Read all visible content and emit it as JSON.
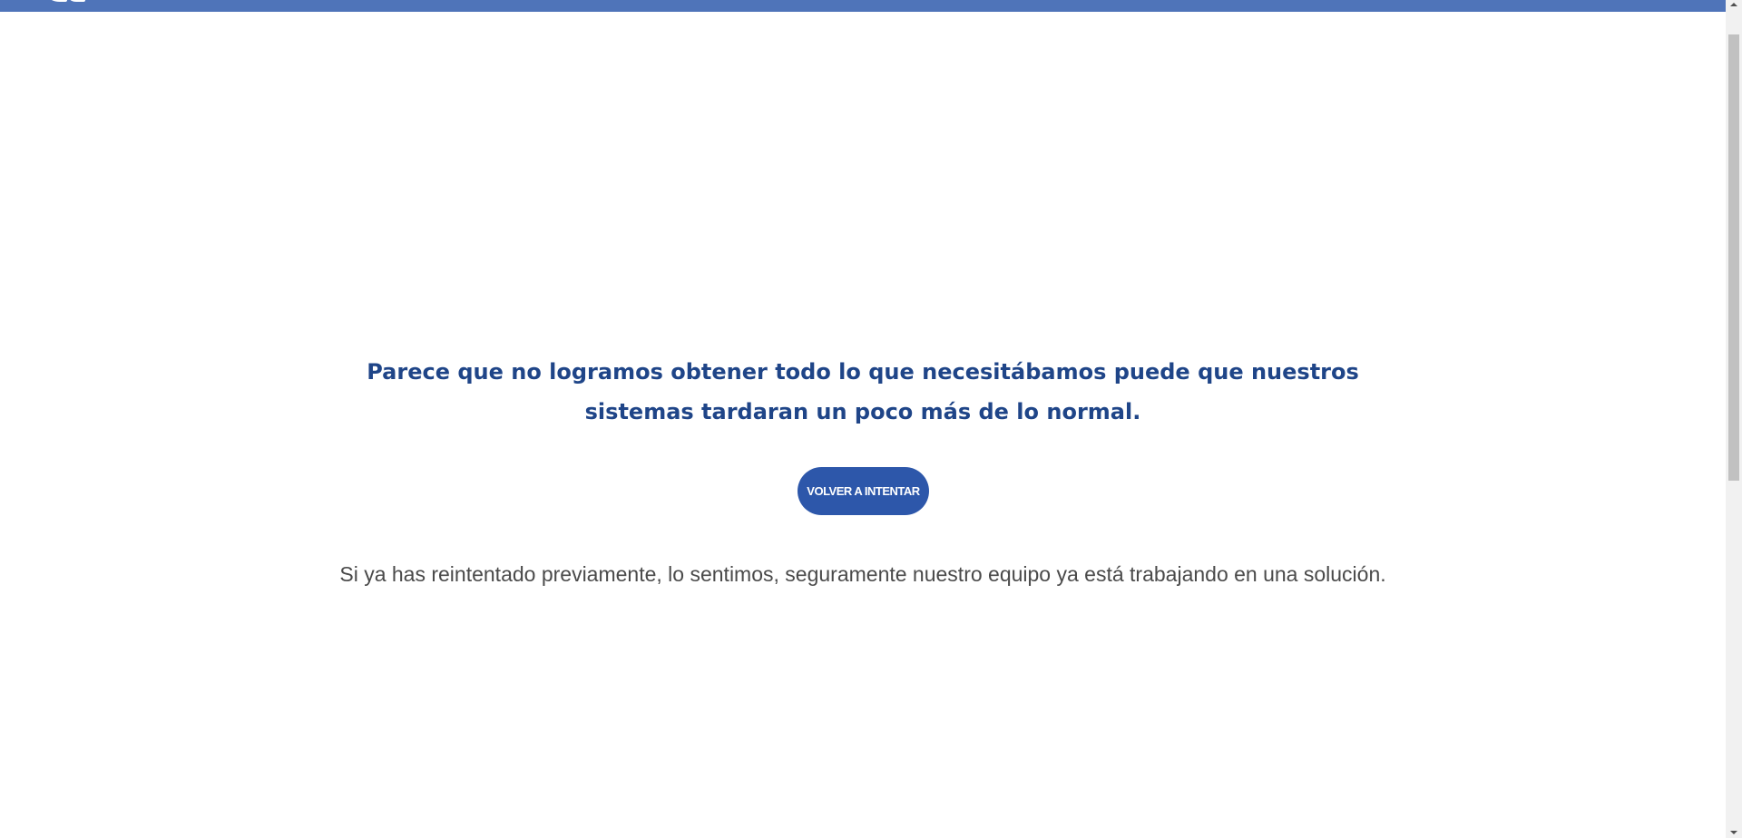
{
  "header": {
    "logo_icon": "brand-logo-icon",
    "bar_color": "#4f74b9"
  },
  "error": {
    "headline": "Parece que no logramos obtener todo lo que necesitábamos puede que nuestros sistemas tardaran un poco más de lo normal.",
    "retry_label": "VOLVER A INTENTAR",
    "subtext": "Si ya has reintentado previamente, lo sentimos, seguramente nuestro equipo ya está trabajando en una solución."
  },
  "colors": {
    "headline": "#1f4588",
    "button": "#2d57aa",
    "subtext": "#4a4a4a"
  }
}
